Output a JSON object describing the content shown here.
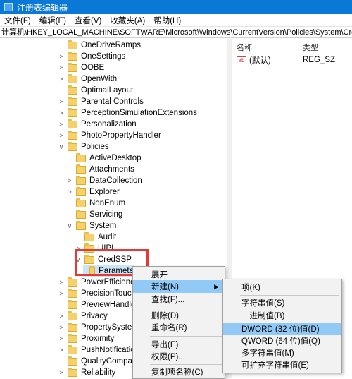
{
  "window": {
    "title": "注册表编辑器"
  },
  "menu": [
    "文件(F)",
    "编辑(E)",
    "查看(V)",
    "收藏夹(A)",
    "帮助(H)"
  ],
  "address": "计算机\\HKEY_LOCAL_MACHINE\\SOFTWARE\\Microsoft\\Windows\\CurrentVersion\\Policies\\System\\CredSSP\\Pa",
  "tree": [
    {
      "label": "OneDriveRamps",
      "chev": ""
    },
    {
      "label": "OneSettings",
      "chev": ">"
    },
    {
      "label": "OOBE",
      "chev": ">"
    },
    {
      "label": "OpenWith",
      "chev": ">"
    },
    {
      "label": "OptimalLayout",
      "chev": ""
    },
    {
      "label": "Parental Controls",
      "chev": ">"
    },
    {
      "label": "PerceptionSimulationExtensions",
      "chev": ">"
    },
    {
      "label": "Personalization",
      "chev": ">"
    },
    {
      "label": "PhotoPropertyHandler",
      "chev": ">"
    },
    {
      "label": "Policies",
      "chev": "v"
    },
    {
      "label": "ActiveDesktop",
      "chev": ""
    },
    {
      "label": "Attachments",
      "chev": ""
    },
    {
      "label": "DataCollection",
      "chev": ">"
    },
    {
      "label": "Explorer",
      "chev": ">"
    },
    {
      "label": "NonEnum",
      "chev": ""
    },
    {
      "label": "Servicing",
      "chev": ""
    },
    {
      "label": "System",
      "chev": "v"
    },
    {
      "label": "Audit",
      "chev": ""
    },
    {
      "label": "UIPI",
      "chev": ">"
    },
    {
      "label": "CredSSP",
      "chev": "v"
    },
    {
      "label": "Paramete",
      "chev": ""
    },
    {
      "label": "PowerEfficiencyD",
      "chev": ">"
    },
    {
      "label": "PrecisionTouchPa",
      "chev": ">"
    },
    {
      "label": "PreviewHandlers",
      "chev": ""
    },
    {
      "label": "Privacy",
      "chev": ">"
    },
    {
      "label": "PropertySystem",
      "chev": ">"
    },
    {
      "label": "Proximity",
      "chev": ">"
    },
    {
      "label": "PushNotifications",
      "chev": ">"
    },
    {
      "label": "QualityCompat",
      "chev": ""
    },
    {
      "label": "Reliability",
      "chev": ">"
    }
  ],
  "list": {
    "col_name": "名称",
    "col_type": "类型",
    "row_name": "(默认)",
    "row_type": "REG_SZ",
    "icon_text": "ab"
  },
  "context_menu": {
    "expand": "展开",
    "new": "新建(N)",
    "find": "查找(F)...",
    "delete": "删除(D)",
    "rename": "重命名(R)",
    "export": "导出(E)",
    "permissions": "权限(P)...",
    "copy_key": "复制项名称(C)"
  },
  "submenu": {
    "key": "项(K)",
    "string": "字符串值(S)",
    "binary": "二进制值(B)",
    "dword": "DWORD (32 位)值(D)",
    "qword": "QWORD (64 位)值(Q)",
    "multi": "多字符串值(M)",
    "expand_string": "可扩充字符串值(E)"
  }
}
